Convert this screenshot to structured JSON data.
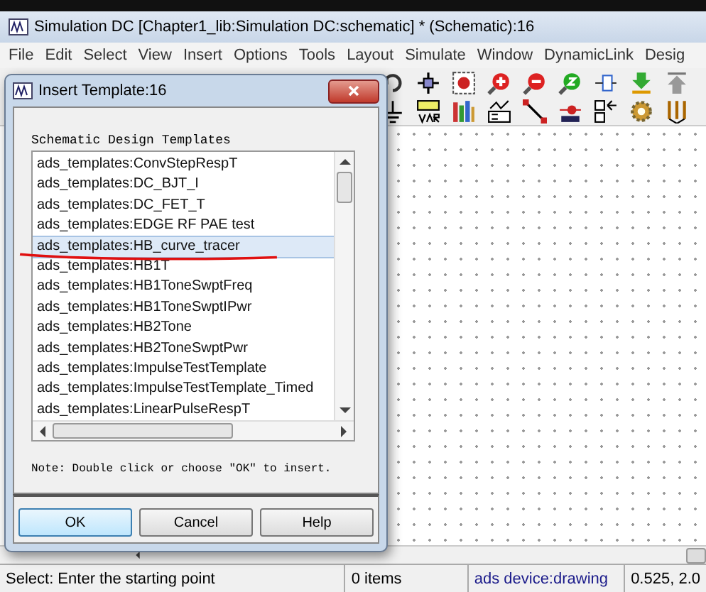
{
  "window": {
    "title": "Simulation DC [Chapter1_lib:Simulation DC:schematic] * (Schematic):16"
  },
  "menu": [
    "File",
    "Edit",
    "Select",
    "View",
    "Insert",
    "Options",
    "Tools",
    "Layout",
    "Simulate",
    "Window",
    "DynamicLink",
    "Desig"
  ],
  "toolbar_icons": [
    {
      "kind": "undo"
    },
    {
      "kind": "move"
    },
    {
      "kind": "zoom-area"
    },
    {
      "kind": "zoom-in"
    },
    {
      "kind": "zoom-out"
    },
    {
      "kind": "zoom-fit"
    },
    {
      "kind": "connect"
    },
    {
      "kind": "push"
    },
    {
      "kind": "pop"
    }
  ],
  "palette_icons": [
    {
      "kind": "ground"
    },
    {
      "kind": "var"
    },
    {
      "kind": "library"
    },
    {
      "kind": "equation"
    },
    {
      "kind": "wire"
    },
    {
      "kind": "name"
    },
    {
      "kind": "swap"
    },
    {
      "kind": "gear"
    },
    {
      "kind": "probe"
    }
  ],
  "dialog": {
    "title": "Insert Template:16",
    "list_label": "Schematic Design Templates",
    "items": [
      {
        "text": "ads_templates:ConvStepRespT",
        "selected": false
      },
      {
        "text": "ads_templates:DC_BJT_I",
        "selected": false
      },
      {
        "text": "ads_templates:DC_FET_T",
        "selected": false
      },
      {
        "text": "ads_templates:EDGE RF PAE test",
        "selected": false
      },
      {
        "text": "ads_templates:HB_curve_tracer",
        "selected": true
      },
      {
        "text": "ads_templates:HB1T",
        "selected": false
      },
      {
        "text": "ads_templates:HB1ToneSwptFreq",
        "selected": false
      },
      {
        "text": "ads_templates:HB1ToneSwptIPwr",
        "selected": false
      },
      {
        "text": "ads_templates:HB2Tone",
        "selected": false
      },
      {
        "text": "ads_templates:HB2ToneSwptPwr",
        "selected": false
      },
      {
        "text": "ads_templates:ImpulseTestTemplate",
        "selected": false
      },
      {
        "text": "ads_templates:ImpulseTestTemplate_Timed",
        "selected": false
      },
      {
        "text": "ads_templates:LinearPulseRespT",
        "selected": false
      }
    ],
    "note": "Note: Double click or choose \"OK\" to insert.",
    "buttons": [
      "OK",
      "Cancel",
      "Help"
    ]
  },
  "status_bar": [
    "Select: Enter the starting point",
    "0 items",
    "ads device:drawing",
    "0.525, 2.0"
  ]
}
